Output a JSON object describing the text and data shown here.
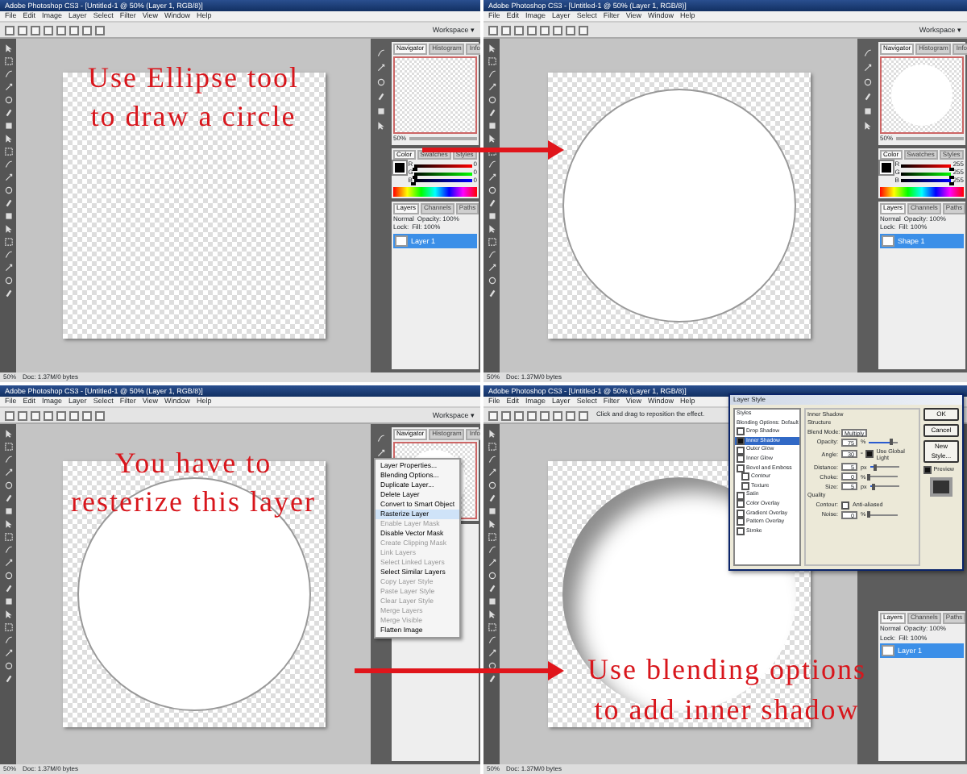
{
  "panels": [
    {
      "title": "Adobe Photoshop CS3 - [Untitled-1 @ 50% (Layer 1, RGB/8)]",
      "menu": [
        "File",
        "Edit",
        "Image",
        "Layer",
        "Select",
        "Filter",
        "View",
        "Window",
        "Help"
      ],
      "workspace": "Workspace ▾",
      "circle": false,
      "annotation": {
        "at_bottom": false,
        "lines": [
          "Use Ellipse tool",
          "to draw a circle"
        ]
      },
      "status": {
        "zoom": "50%",
        "info": "Doc: 1.37M/0 bytes"
      },
      "navigator": {
        "tabs": [
          {
            "label": "Navigator",
            "selected": true
          },
          {
            "label": "Histogram",
            "selected": false
          },
          {
            "label": "Info",
            "selected": false
          }
        ],
        "thumb_circle": false,
        "zoom": "50%"
      },
      "color": {
        "tabs": [
          {
            "label": "Color",
            "selected": true
          },
          {
            "label": "Swatches",
            "selected": false
          },
          {
            "label": "Styles",
            "selected": false
          }
        ],
        "channels": [
          {
            "label": "R",
            "value": "0",
            "level": 0
          },
          {
            "label": "G",
            "value": "0",
            "level": 0
          },
          {
            "label": "B",
            "value": "0",
            "level": 0
          }
        ]
      },
      "layers": {
        "tabs": [
          {
            "label": "Layers",
            "selected": true
          },
          {
            "label": "Channels",
            "selected": false
          },
          {
            "label": "Paths",
            "selected": false
          }
        ],
        "blend_mode": "Normal",
        "opacity": "Opacity: 100%",
        "fill": "Fill: 100%",
        "lock": "Lock:",
        "rows": [
          {
            "name": "Layer 1",
            "selected": true
          }
        ]
      }
    },
    {
      "title": "Adobe Photoshop CS3 - [Untitled-1 @ 50% (Layer 1, RGB/8)]",
      "menu": [
        "File",
        "Edit",
        "Image",
        "Layer",
        "Select",
        "Filter",
        "View",
        "Window",
        "Help"
      ],
      "workspace": "Workspace ▾",
      "circle": true,
      "inner_shadow": false,
      "status": {
        "zoom": "50%",
        "info": "Doc: 1.37M/0 bytes"
      },
      "navigator": {
        "tabs": [
          {
            "label": "Navigator",
            "selected": true
          },
          {
            "label": "Histogram",
            "selected": false
          },
          {
            "label": "Info",
            "selected": false
          }
        ],
        "thumb_circle": true,
        "zoom": "50%"
      },
      "color": {
        "tabs": [
          {
            "label": "Color",
            "selected": true
          },
          {
            "label": "Swatches",
            "selected": false
          },
          {
            "label": "Styles",
            "selected": false
          }
        ],
        "channels": [
          {
            "label": "R",
            "value": "255",
            "level": 1
          },
          {
            "label": "G",
            "value": "255",
            "level": 1
          },
          {
            "label": "B",
            "value": "255",
            "level": 1
          }
        ]
      },
      "layers": {
        "tabs": [
          {
            "label": "Layers",
            "selected": true
          },
          {
            "label": "Channels",
            "selected": false
          },
          {
            "label": "Paths",
            "selected": false
          }
        ],
        "blend_mode": "Normal",
        "opacity": "Opacity: 100%",
        "fill": "Fill: 100%",
        "lock": "Lock:",
        "rows": [
          {
            "name": "Shape 1",
            "selected": true
          }
        ]
      }
    },
    {
      "title": "Adobe Photoshop CS3 - [Untitled-1 @ 50% (Layer 1, RGB/8)]",
      "menu": [
        "File",
        "Edit",
        "Image",
        "Layer",
        "Select",
        "Filter",
        "View",
        "Window",
        "Help"
      ],
      "workspace": "Workspace ▾",
      "circle": true,
      "inner_shadow": false,
      "annotation": {
        "at_bottom": false,
        "lines": [
          "You have to",
          "resterize this layer"
        ]
      },
      "status": {
        "zoom": "50%",
        "info": "Doc: 1.37M/0 bytes"
      },
      "navigator": {
        "tabs": [
          {
            "label": "Navigator",
            "selected": true
          },
          {
            "label": "Histogram",
            "selected": false
          },
          {
            "label": "Info",
            "selected": false
          }
        ],
        "thumb_circle": true
      },
      "context_menu": [
        {
          "label": "Layer Properties...",
          "disabled": false,
          "selected": false
        },
        {
          "label": "Blending Options...",
          "disabled": false,
          "selected": false
        },
        {
          "label": "Duplicate Layer...",
          "disabled": false,
          "selected": false
        },
        {
          "label": "Delete Layer",
          "disabled": false,
          "selected": false
        },
        {
          "label": "Convert to Smart Object",
          "disabled": false,
          "selected": false
        },
        {
          "label": "Rasterize Layer",
          "disabled": false,
          "selected": true
        },
        {
          "label": "Enable Layer Mask",
          "disabled": true,
          "selected": false
        },
        {
          "label": "Disable Vector Mask",
          "disabled": false,
          "selected": false
        },
        {
          "label": "Create Clipping Mask",
          "disabled": true,
          "selected": false
        },
        {
          "label": "Link Layers",
          "disabled": true,
          "selected": false
        },
        {
          "label": "Select Linked Layers",
          "disabled": true,
          "selected": false
        },
        {
          "label": "Select Similar Layers",
          "disabled": false,
          "selected": false
        },
        {
          "label": "Copy Layer Style",
          "disabled": true,
          "selected": false
        },
        {
          "label": "Paste Layer Style",
          "disabled": true,
          "selected": false
        },
        {
          "label": "Clear Layer Style",
          "disabled": true,
          "selected": false
        },
        {
          "label": "Merge Layers",
          "disabled": true,
          "selected": false
        },
        {
          "label": "Merge Visible",
          "disabled": true,
          "selected": false
        },
        {
          "label": "Flatten Image",
          "disabled": false,
          "selected": false
        }
      ]
    },
    {
      "title": "Adobe Photoshop CS3 - [Untitled-1 @ 50% (Layer 1, RGB/8)]",
      "menu": [
        "File",
        "Edit",
        "Image",
        "Layer",
        "Select",
        "Filter",
        "View",
        "Window",
        "Help"
      ],
      "options_text": "Click and drag to reposition the effect.",
      "circle": true,
      "inner_shadow": true,
      "annotation": {
        "at_bottom": true,
        "lines": [
          "Use blending options",
          "to add inner shadow"
        ]
      },
      "status": {
        "zoom": "50%",
        "info": "Doc: 1.37M/0 bytes"
      },
      "layers": {
        "tabs": [
          {
            "label": "Layers",
            "selected": true
          },
          {
            "label": "Channels",
            "selected": false
          },
          {
            "label": "Paths",
            "selected": false
          }
        ],
        "blend_mode": "Normal",
        "opacity": "Opacity: 100%",
        "fill": "Fill: 100%",
        "lock": "Lock:",
        "rows": [
          {
            "name": "Layer 1",
            "selected": true
          }
        ]
      },
      "dialog": {
        "title": "Layer Style",
        "styles": [
          {
            "label": "Styles",
            "selected": false,
            "kind": "heading"
          },
          {
            "label": "Blending Options: Default",
            "selected": false,
            "kind": "heading"
          },
          {
            "label": "Drop Shadow",
            "selected": false,
            "kind": "effect",
            "checked": false
          },
          {
            "label": "Inner Shadow",
            "selected": true,
            "kind": "effect",
            "checked": true
          },
          {
            "label": "Outer Glow",
            "selected": false,
            "kind": "effect",
            "checked": false
          },
          {
            "label": "Inner Glow",
            "selected": false,
            "kind": "effect",
            "checked": false
          },
          {
            "label": "Bevel and Emboss",
            "selected": false,
            "kind": "effect",
            "checked": false
          },
          {
            "label": "Contour",
            "selected": false,
            "kind": "sub",
            "checked": false
          },
          {
            "label": "Texture",
            "selected": false,
            "kind": "sub",
            "checked": false
          },
          {
            "label": "Satin",
            "selected": false,
            "kind": "effect",
            "checked": false
          },
          {
            "label": "Color Overlay",
            "selected": false,
            "kind": "effect",
            "checked": false
          },
          {
            "label": "Gradient Overlay",
            "selected": false,
            "kind": "effect",
            "checked": false
          },
          {
            "label": "Pattern Overlay",
            "selected": false,
            "kind": "effect",
            "checked": false
          },
          {
            "label": "Stroke",
            "selected": false,
            "kind": "effect",
            "checked": false
          }
        ],
        "section": "Inner Shadow",
        "group": "Structure",
        "fields": [
          {
            "kind": "select",
            "label": "Blend Mode:",
            "value": "Multiply"
          },
          {
            "kind": "slider",
            "label": "Opacity:",
            "value": "75",
            "unit": "%",
            "level": 0.75
          },
          {
            "kind": "angle",
            "label": "Angle:",
            "value": "30",
            "unit": "°"
          },
          {
            "kind": "slider",
            "label": "Distance:",
            "value": "5",
            "unit": "px",
            "level": 0.2
          },
          {
            "kind": "slider",
            "label": "Choke:",
            "value": "0",
            "unit": "%",
            "level": 0
          },
          {
            "kind": "slider",
            "label": "Size:",
            "value": "5",
            "unit": "px",
            "level": 0.1
          }
        ],
        "global_light": {
          "label": "Use Global Light",
          "checked": true
        },
        "quality": "Quality",
        "contour": "Contour:",
        "anti_aliased": {
          "label": "Anti-aliased",
          "checked": false
        },
        "noise": {
          "label": "Noise:",
          "value": "0",
          "unit": "%",
          "level": 0
        },
        "buttons": [
          "OK",
          "Cancel",
          "New Style..."
        ],
        "preview": {
          "label": "Preview",
          "checked": true
        }
      }
    }
  ]
}
